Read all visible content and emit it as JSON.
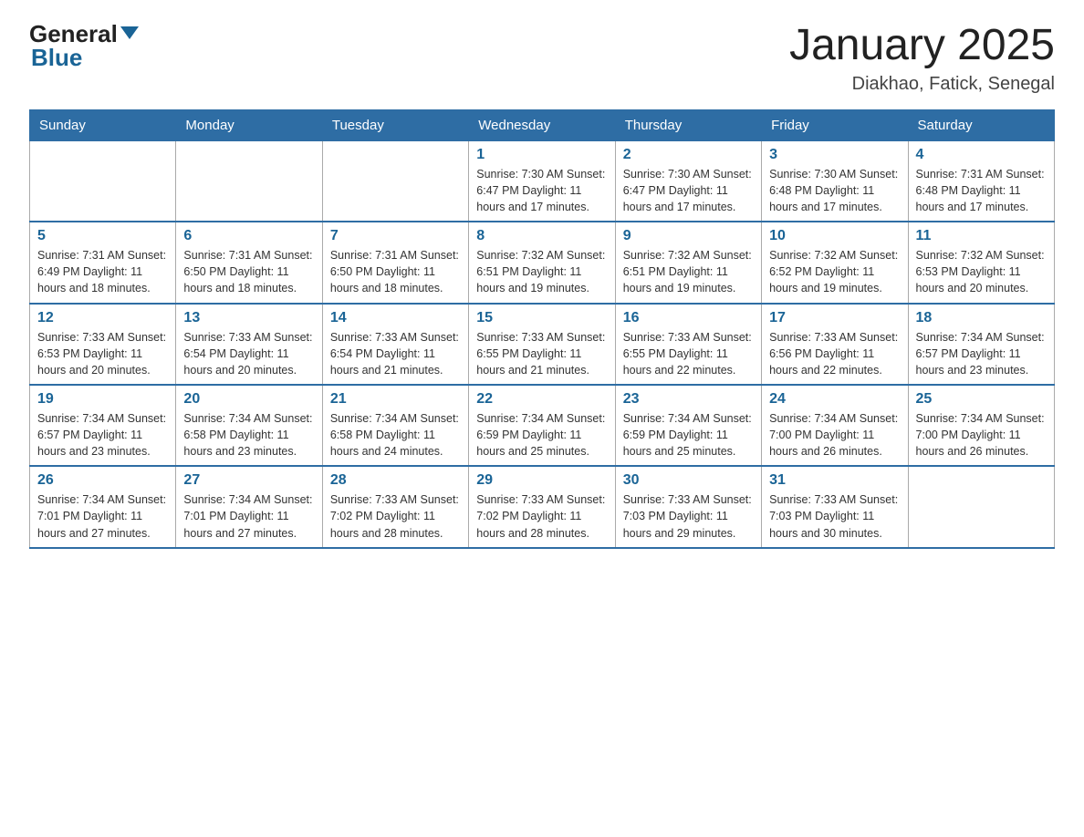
{
  "header": {
    "logo_general": "General",
    "logo_blue": "Blue",
    "title": "January 2025",
    "subtitle": "Diakhao, Fatick, Senegal"
  },
  "weekdays": [
    "Sunday",
    "Monday",
    "Tuesday",
    "Wednesday",
    "Thursday",
    "Friday",
    "Saturday"
  ],
  "weeks": [
    [
      {
        "day": "",
        "info": ""
      },
      {
        "day": "",
        "info": ""
      },
      {
        "day": "",
        "info": ""
      },
      {
        "day": "1",
        "info": "Sunrise: 7:30 AM\nSunset: 6:47 PM\nDaylight: 11 hours and 17 minutes."
      },
      {
        "day": "2",
        "info": "Sunrise: 7:30 AM\nSunset: 6:47 PM\nDaylight: 11 hours and 17 minutes."
      },
      {
        "day": "3",
        "info": "Sunrise: 7:30 AM\nSunset: 6:48 PM\nDaylight: 11 hours and 17 minutes."
      },
      {
        "day": "4",
        "info": "Sunrise: 7:31 AM\nSunset: 6:48 PM\nDaylight: 11 hours and 17 minutes."
      }
    ],
    [
      {
        "day": "5",
        "info": "Sunrise: 7:31 AM\nSunset: 6:49 PM\nDaylight: 11 hours and 18 minutes."
      },
      {
        "day": "6",
        "info": "Sunrise: 7:31 AM\nSunset: 6:50 PM\nDaylight: 11 hours and 18 minutes."
      },
      {
        "day": "7",
        "info": "Sunrise: 7:31 AM\nSunset: 6:50 PM\nDaylight: 11 hours and 18 minutes."
      },
      {
        "day": "8",
        "info": "Sunrise: 7:32 AM\nSunset: 6:51 PM\nDaylight: 11 hours and 19 minutes."
      },
      {
        "day": "9",
        "info": "Sunrise: 7:32 AM\nSunset: 6:51 PM\nDaylight: 11 hours and 19 minutes."
      },
      {
        "day": "10",
        "info": "Sunrise: 7:32 AM\nSunset: 6:52 PM\nDaylight: 11 hours and 19 minutes."
      },
      {
        "day": "11",
        "info": "Sunrise: 7:32 AM\nSunset: 6:53 PM\nDaylight: 11 hours and 20 minutes."
      }
    ],
    [
      {
        "day": "12",
        "info": "Sunrise: 7:33 AM\nSunset: 6:53 PM\nDaylight: 11 hours and 20 minutes."
      },
      {
        "day": "13",
        "info": "Sunrise: 7:33 AM\nSunset: 6:54 PM\nDaylight: 11 hours and 20 minutes."
      },
      {
        "day": "14",
        "info": "Sunrise: 7:33 AM\nSunset: 6:54 PM\nDaylight: 11 hours and 21 minutes."
      },
      {
        "day": "15",
        "info": "Sunrise: 7:33 AM\nSunset: 6:55 PM\nDaylight: 11 hours and 21 minutes."
      },
      {
        "day": "16",
        "info": "Sunrise: 7:33 AM\nSunset: 6:55 PM\nDaylight: 11 hours and 22 minutes."
      },
      {
        "day": "17",
        "info": "Sunrise: 7:33 AM\nSunset: 6:56 PM\nDaylight: 11 hours and 22 minutes."
      },
      {
        "day": "18",
        "info": "Sunrise: 7:34 AM\nSunset: 6:57 PM\nDaylight: 11 hours and 23 minutes."
      }
    ],
    [
      {
        "day": "19",
        "info": "Sunrise: 7:34 AM\nSunset: 6:57 PM\nDaylight: 11 hours and 23 minutes."
      },
      {
        "day": "20",
        "info": "Sunrise: 7:34 AM\nSunset: 6:58 PM\nDaylight: 11 hours and 23 minutes."
      },
      {
        "day": "21",
        "info": "Sunrise: 7:34 AM\nSunset: 6:58 PM\nDaylight: 11 hours and 24 minutes."
      },
      {
        "day": "22",
        "info": "Sunrise: 7:34 AM\nSunset: 6:59 PM\nDaylight: 11 hours and 25 minutes."
      },
      {
        "day": "23",
        "info": "Sunrise: 7:34 AM\nSunset: 6:59 PM\nDaylight: 11 hours and 25 minutes."
      },
      {
        "day": "24",
        "info": "Sunrise: 7:34 AM\nSunset: 7:00 PM\nDaylight: 11 hours and 26 minutes."
      },
      {
        "day": "25",
        "info": "Sunrise: 7:34 AM\nSunset: 7:00 PM\nDaylight: 11 hours and 26 minutes."
      }
    ],
    [
      {
        "day": "26",
        "info": "Sunrise: 7:34 AM\nSunset: 7:01 PM\nDaylight: 11 hours and 27 minutes."
      },
      {
        "day": "27",
        "info": "Sunrise: 7:34 AM\nSunset: 7:01 PM\nDaylight: 11 hours and 27 minutes."
      },
      {
        "day": "28",
        "info": "Sunrise: 7:33 AM\nSunset: 7:02 PM\nDaylight: 11 hours and 28 minutes."
      },
      {
        "day": "29",
        "info": "Sunrise: 7:33 AM\nSunset: 7:02 PM\nDaylight: 11 hours and 28 minutes."
      },
      {
        "day": "30",
        "info": "Sunrise: 7:33 AM\nSunset: 7:03 PM\nDaylight: 11 hours and 29 minutes."
      },
      {
        "day": "31",
        "info": "Sunrise: 7:33 AM\nSunset: 7:03 PM\nDaylight: 11 hours and 30 minutes."
      },
      {
        "day": "",
        "info": ""
      }
    ]
  ]
}
